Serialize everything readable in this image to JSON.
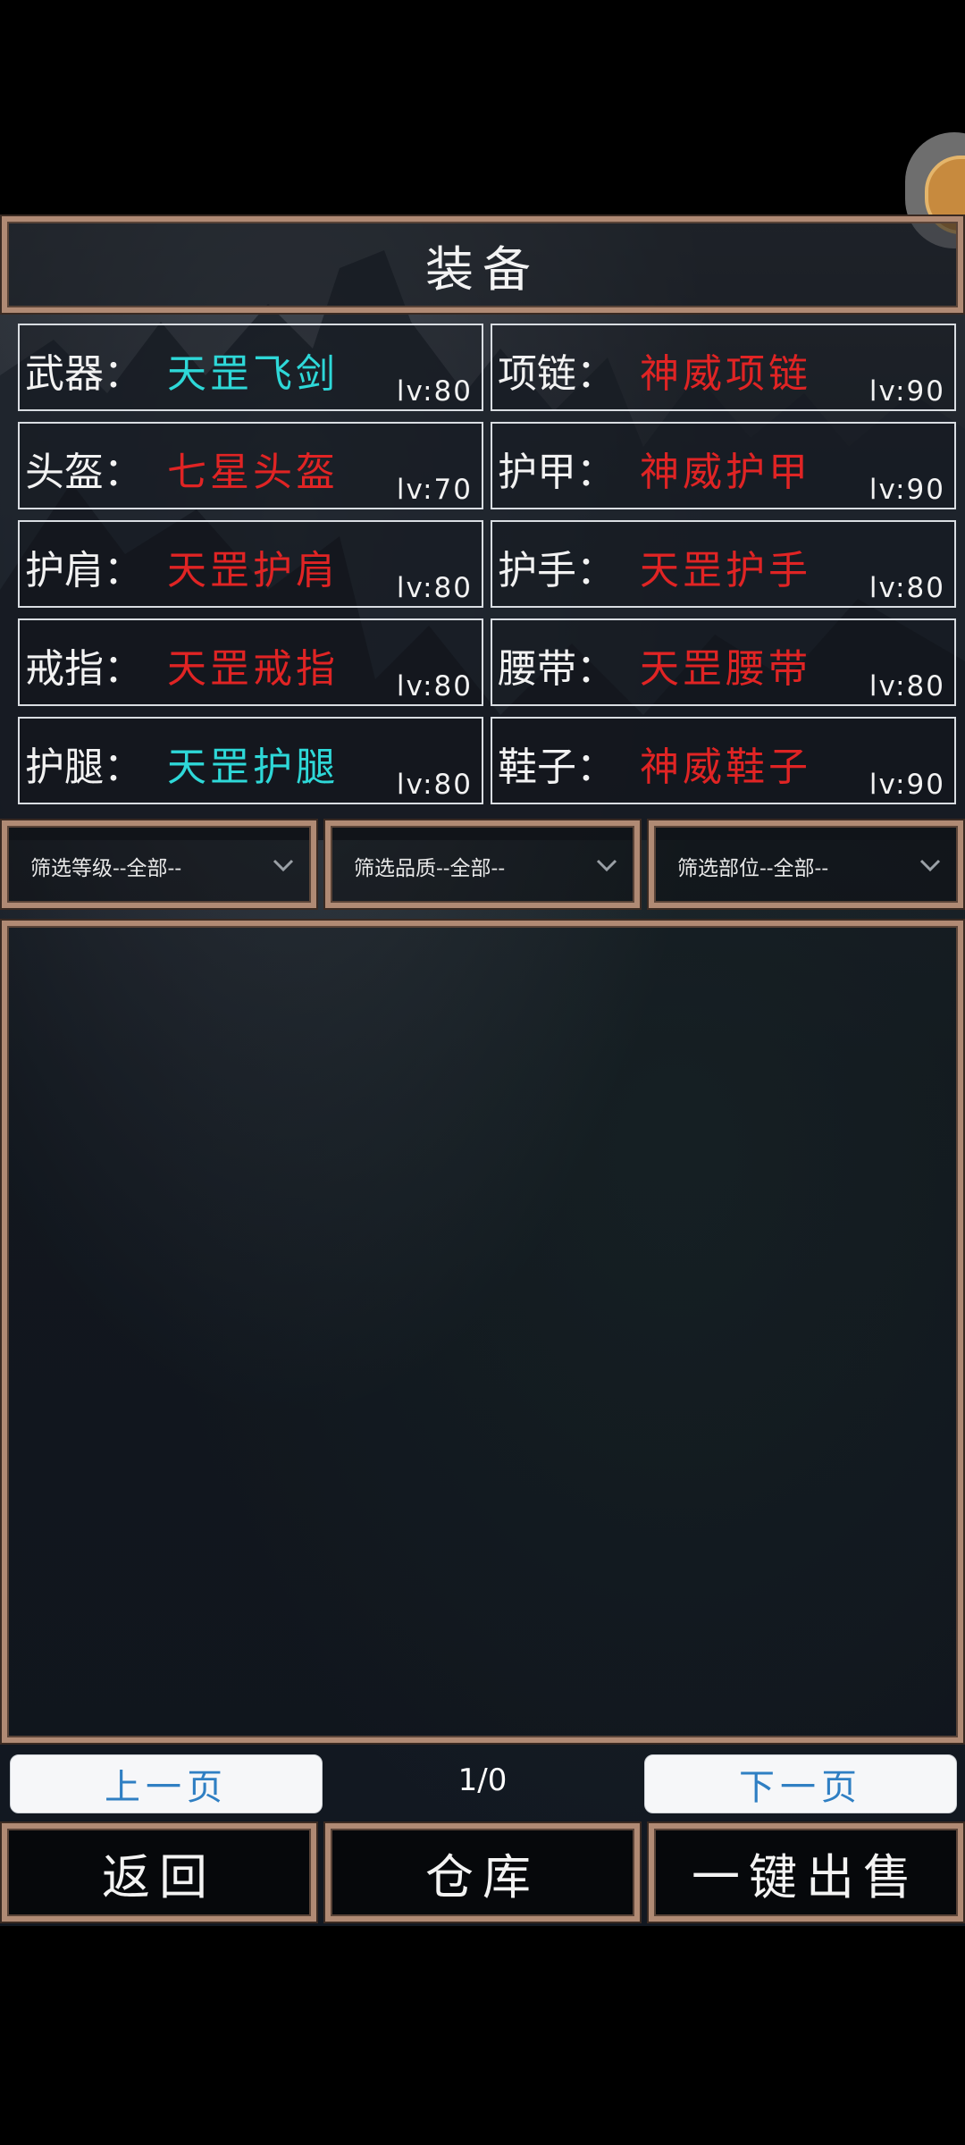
{
  "title": "装备",
  "equipment_slots": [
    {
      "label": "武器：",
      "name": "天罡飞剑",
      "level": "lv:80",
      "color": "#2ed8d8"
    },
    {
      "label": "项链：",
      "name": "神威项链",
      "level": "lv:90",
      "color": "#e02424"
    },
    {
      "label": "头盔：",
      "name": "七星头盔",
      "level": "lv:70",
      "color": "#e02424"
    },
    {
      "label": "护甲：",
      "name": "神威护甲",
      "level": "lv:90",
      "color": "#e02424"
    },
    {
      "label": "护肩：",
      "name": "天罡护肩",
      "level": "lv:80",
      "color": "#e02424"
    },
    {
      "label": "护手：",
      "name": "天罡护手",
      "level": "lv:80",
      "color": "#e02424"
    },
    {
      "label": "戒指：",
      "name": "天罡戒指",
      "level": "lv:80",
      "color": "#e02424"
    },
    {
      "label": "腰带：",
      "name": "天罡腰带",
      "level": "lv:80",
      "color": "#e02424"
    },
    {
      "label": "护腿：",
      "name": "天罡护腿",
      "level": "lv:80",
      "color": "#2ed8d8"
    },
    {
      "label": "鞋子：",
      "name": "神威鞋子",
      "level": "lv:90",
      "color": "#e02424"
    }
  ],
  "filters": {
    "level": "筛选等级--全部--",
    "quality": "筛选品质--全部--",
    "slot": "筛选部位--全部--"
  },
  "pagination": {
    "prev": "上一页",
    "indicator": "1/0",
    "next": "下一页"
  },
  "actions": {
    "back": "返回",
    "warehouse": "仓库",
    "sell_all": "一键出售"
  },
  "colors": {
    "frame": "#b08a74",
    "cyan_item": "#2ed8d8",
    "red_item": "#e02424",
    "page_button_text": "#2f7fc3"
  }
}
